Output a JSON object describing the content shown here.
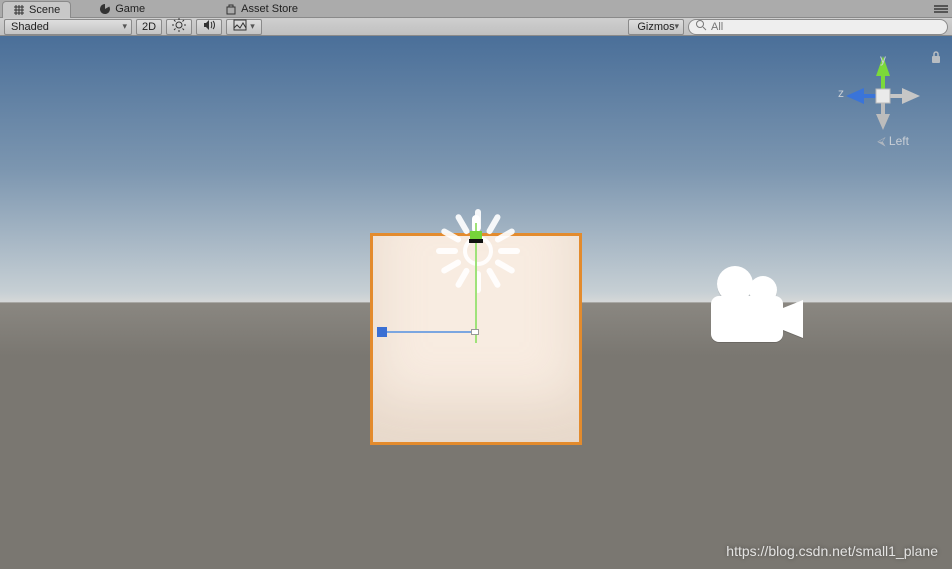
{
  "tabs": {
    "scene": "Scene",
    "game": "Game",
    "asset_store": "Asset Store"
  },
  "toolbar": {
    "draw_mode": "Shaded",
    "btn_2d": "2D",
    "gizmos_label": "Gizmos",
    "search_placeholder": "All"
  },
  "orient": {
    "y": "y",
    "z": "z",
    "left_label": "Left"
  },
  "icons": {
    "scene_hash": "#",
    "lock": "🔒"
  },
  "watermark": "https://blog.csdn.net/small1_plane"
}
